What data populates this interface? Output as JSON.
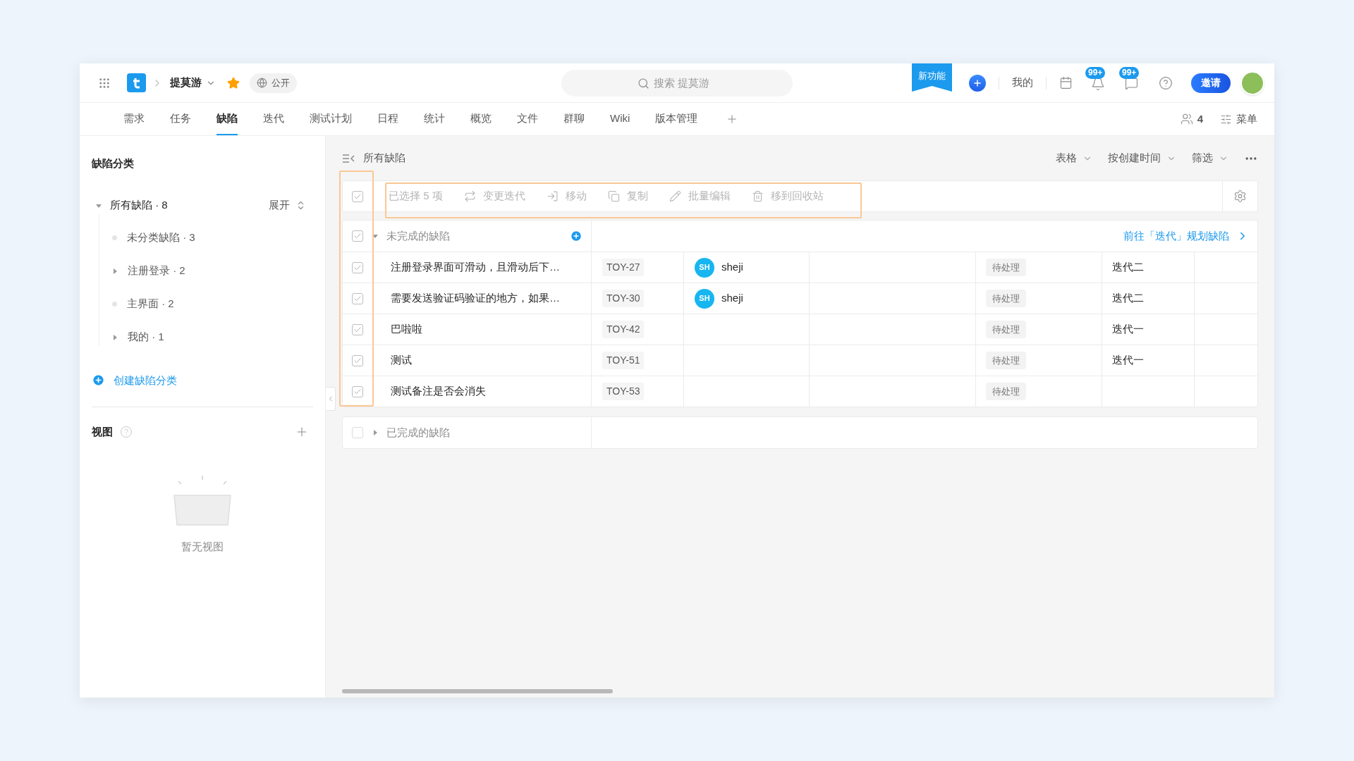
{
  "header": {
    "project": "提莫游",
    "starred": true,
    "visibility": "公开",
    "search_placeholder": "搜索 提莫游",
    "new_feature": "新功能",
    "my": "我的",
    "notifications_badge": "99+",
    "messages_badge": "99+",
    "invite": "邀请"
  },
  "tabs": [
    {
      "label": "需求",
      "selected": false
    },
    {
      "label": "任务",
      "selected": false
    },
    {
      "label": "缺陷",
      "selected": true
    },
    {
      "label": "迭代",
      "selected": false
    },
    {
      "label": "测试计划",
      "selected": false
    },
    {
      "label": "日程",
      "selected": false
    },
    {
      "label": "统计",
      "selected": false
    },
    {
      "label": "概览",
      "selected": false
    },
    {
      "label": "文件",
      "selected": false
    },
    {
      "label": "群聊",
      "selected": false
    },
    {
      "label": "Wiki",
      "selected": false
    },
    {
      "label": "版本管理",
      "selected": false
    }
  ],
  "tab_actions": {
    "members": "4",
    "menu": "菜单"
  },
  "sidebar": {
    "title": "缺陷分类",
    "tree": [
      {
        "label": "所有缺陷 · 8",
        "expanded": true,
        "children": [
          {
            "label": "未分类缺陷 · 3",
            "kind": "leaf"
          },
          {
            "label": "注册登录 · 2",
            "kind": "folder"
          },
          {
            "label": "主界面 · 2",
            "kind": "leaf"
          },
          {
            "label": "我的 · 1",
            "kind": "folder"
          }
        ]
      }
    ],
    "expand_button": "展开",
    "create_link": "创建缺陷分类",
    "views_title": "视图",
    "views_empty": "暂无视图"
  },
  "main": {
    "title": "所有缺陷",
    "controls": [
      "表格",
      "按创建时间",
      "筛选"
    ],
    "toolbar": {
      "checked": true,
      "selection": "已选择 5 项",
      "actions": [
        {
          "kind": "iteration",
          "label": "变更迭代"
        },
        {
          "kind": "move",
          "label": "移动"
        },
        {
          "kind": "copy",
          "label": "复制"
        },
        {
          "kind": "edit",
          "label": "批量编辑"
        },
        {
          "kind": "trash",
          "label": "移到回收站"
        }
      ]
    },
    "groups": [
      {
        "title": "未完成的缺陷",
        "checked": true,
        "expanded": true,
        "link": "前往「迭代」规划缺陷",
        "rows": [
          {
            "checked": true,
            "title": "注册登录界面可滑动，且滑动后下…",
            "id": "TOY-27",
            "assignee": {
              "initials": "SH",
              "name": "sheji"
            },
            "status": "待处理",
            "iteration": "迭代二"
          },
          {
            "checked": true,
            "title": "需要发送验证码验证的地方，如果…",
            "id": "TOY-30",
            "assignee": {
              "initials": "SH",
              "name": "sheji"
            },
            "status": "待处理",
            "iteration": "迭代二"
          },
          {
            "checked": true,
            "title": "巴啦啦",
            "id": "TOY-42",
            "status": "待处理",
            "iteration": "迭代一"
          },
          {
            "checked": true,
            "title": "测试",
            "id": "TOY-51",
            "status": "待处理",
            "iteration": "迭代一"
          },
          {
            "checked": true,
            "title": "测试备注是否会消失",
            "id": "TOY-53",
            "status": "待处理"
          }
        ]
      },
      {
        "title": "已完成的缺陷",
        "checked": false,
        "expanded": false
      }
    ]
  }
}
